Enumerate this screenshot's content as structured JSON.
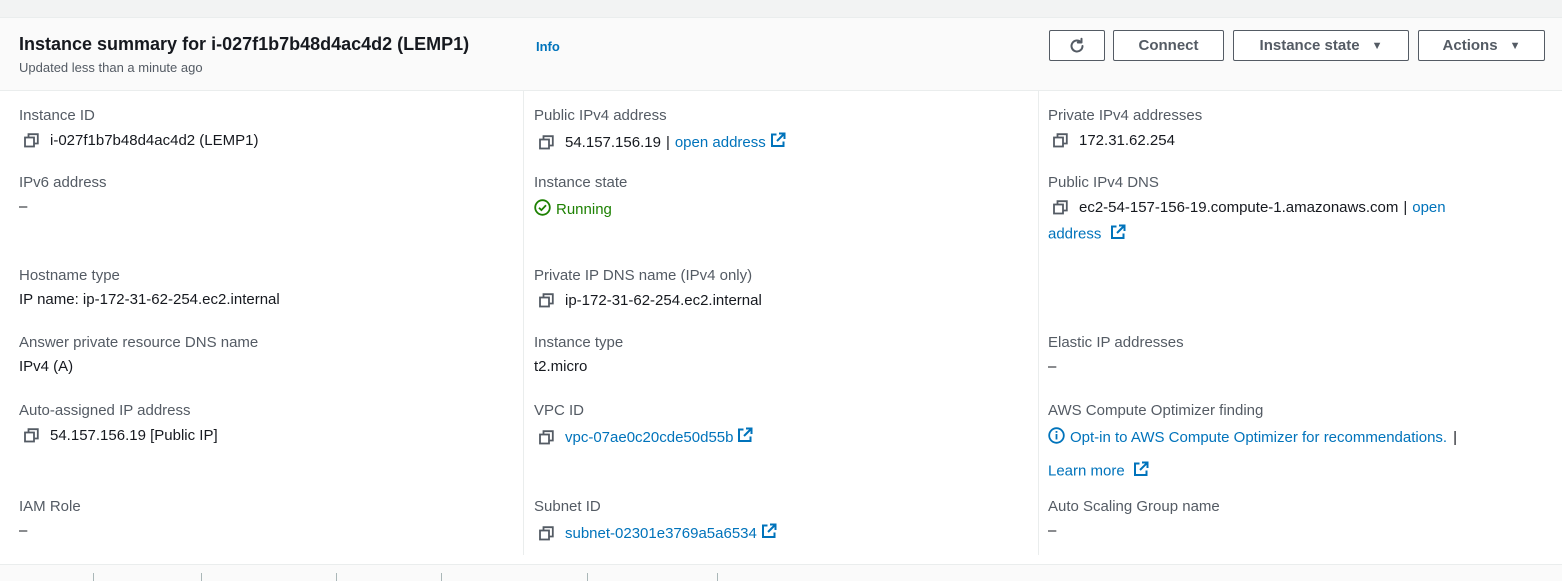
{
  "header": {
    "title": "Instance summary for i-027f1b7b48d4ac4d2 (LEMP1)",
    "info_label": "Info",
    "subtitle": "Updated less than a minute ago",
    "connect_label": "Connect",
    "instance_state_label": "Instance state",
    "actions_label": "Actions"
  },
  "col1": {
    "instance_id": {
      "label": "Instance ID",
      "value": "i-027f1b7b48d4ac4d2 (LEMP1)"
    },
    "ipv6": {
      "label": "IPv6 address",
      "value": "–"
    },
    "hostname_type": {
      "label": "Hostname type",
      "value": "IP name: ip-172-31-62-254.ec2.internal"
    },
    "answer_dns": {
      "label": "Answer private resource DNS name",
      "value": "IPv4 (A)"
    },
    "auto_ip": {
      "label": "Auto-assigned IP address",
      "value": "54.157.156.19 [Public IP]"
    },
    "iam_role": {
      "label": "IAM Role",
      "value": "–"
    }
  },
  "col2": {
    "public_ipv4": {
      "label": "Public IPv4 address",
      "value": "54.157.156.19",
      "separator": "|",
      "link": "open address"
    },
    "instance_state": {
      "label": "Instance state",
      "value": "Running"
    },
    "private_dns": {
      "label": "Private IP DNS name (IPv4 only)",
      "value": "ip-172-31-62-254.ec2.internal"
    },
    "instance_type": {
      "label": "Instance type",
      "value": "t2.micro"
    },
    "vpc_id": {
      "label": "VPC ID",
      "value": "vpc-07ae0c20cde50d55b"
    },
    "subnet_id": {
      "label": "Subnet ID",
      "value": "subnet-02301e3769a5a6534"
    }
  },
  "col3": {
    "private_ipv4": {
      "label": "Private IPv4 addresses",
      "value": "172.31.62.254"
    },
    "public_dns": {
      "label": "Public IPv4 DNS",
      "value": "ec2-54-157-156-19.compute-1.amazonaws.com",
      "separator": "|",
      "link_part1": "open",
      "link_part2": "address"
    },
    "elastic_ip": {
      "label": "Elastic IP addresses",
      "value": "–"
    },
    "optimizer": {
      "label": "AWS Compute Optimizer finding",
      "link": "Opt-in to AWS Compute Optimizer for recommendations.",
      "separator": "|",
      "learn_more": "Learn more"
    },
    "asg_name": {
      "label": "Auto Scaling Group name",
      "value": "–"
    }
  },
  "colors": {
    "link": "#0073bb",
    "running": "#1d8102",
    "label": "#545b64",
    "text": "#16191f"
  }
}
